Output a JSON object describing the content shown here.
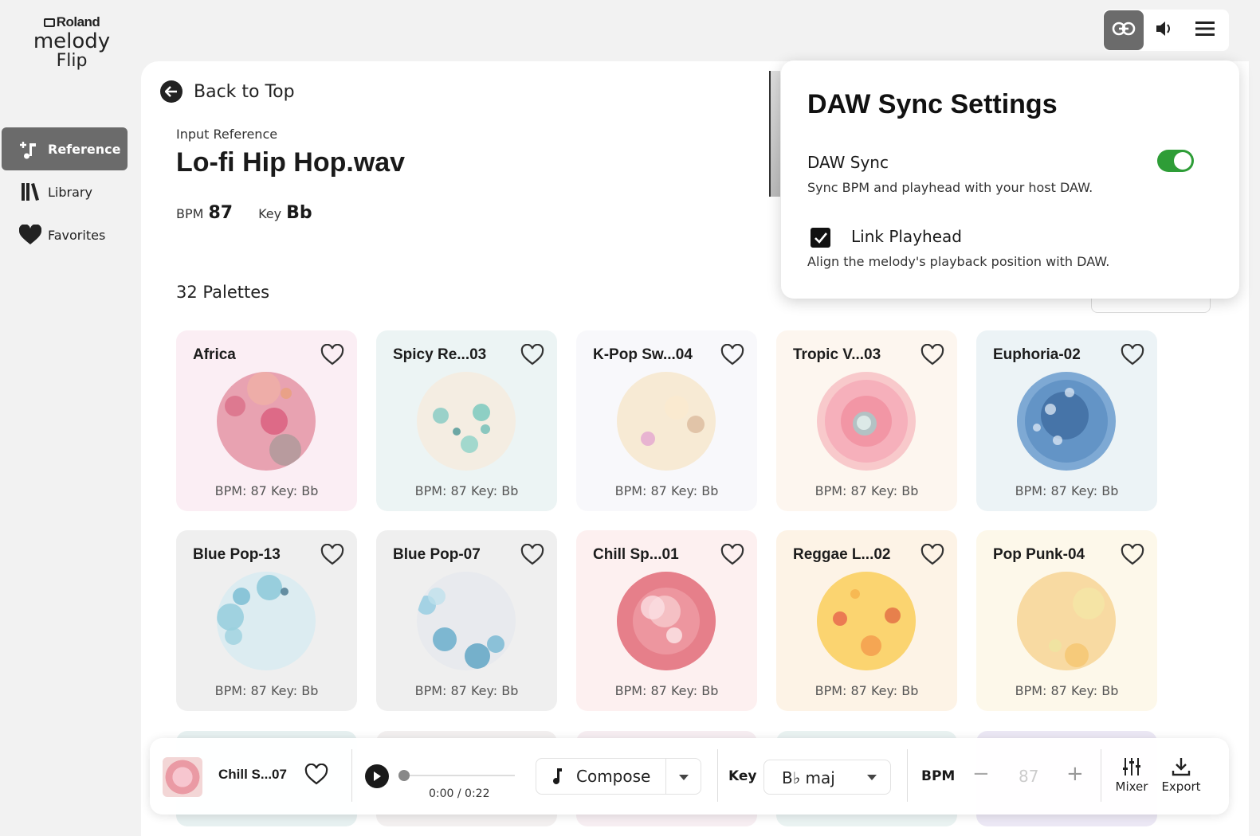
{
  "logo": {
    "brand": "Roland",
    "line1": "melody",
    "line2": "Flip"
  },
  "nav": [
    {
      "label": "Reference",
      "icon": "add-music-icon",
      "active": true
    },
    {
      "label": "Library",
      "icon": "library-icon",
      "active": false
    },
    {
      "label": "Favorites",
      "icon": "heart-filled-icon",
      "active": false
    }
  ],
  "toolbar": {
    "icons": [
      "link-icon",
      "speaker-icon",
      "menu-icon"
    ]
  },
  "main": {
    "back_label": "Back to Top",
    "input_ref_label": "Input Reference",
    "file_title": "Lo-fi Hip Hop.wav",
    "bpm_label": "BPM",
    "bpm_value": "87",
    "key_label": "Key",
    "key_value": "Bb",
    "palettes_count": "32 Palettes"
  },
  "cards": [
    {
      "title": "Africa",
      "info": "BPM: 87  Key: Bb",
      "bg": "#fbeef4",
      "orb": "#e8a2b1"
    },
    {
      "title": "Spicy Re...03",
      "info": "BPM: 87  Key: Bb",
      "bg": "#ecf4f4",
      "orb": "#f4ede2"
    },
    {
      "title": "K-Pop Sw...04",
      "info": "BPM: 87  Key: Bb",
      "bg": "#f8f8fb",
      "orb": "#f7ead4"
    },
    {
      "title": "Tropic V...03",
      "info": "BPM: 87  Key: Bb",
      "bg": "#fdf6ef",
      "orb": "#f8c9cb"
    },
    {
      "title": "Euphoria-02",
      "info": "BPM: 87  Key: Bb",
      "bg": "#ecf3f6",
      "orb": "#7ea9d4"
    },
    {
      "title": "Blue Pop-13",
      "info": "BPM: 87  Key: Bb",
      "bg": "#efefef",
      "orb": "#dcecf1"
    },
    {
      "title": "Blue Pop-07",
      "info": "BPM: 87  Key: Bb",
      "bg": "#efefef",
      "orb": "#e8eaee"
    },
    {
      "title": "Chill Sp...01",
      "info": "BPM: 87  Key: Bb",
      "bg": "#fdf0f0",
      "orb": "#e7878f"
    },
    {
      "title": "Reggae L...02",
      "info": "BPM: 87  Key: Bb",
      "bg": "#fdf3e6",
      "orb": "#fbd77a"
    },
    {
      "title": "Pop Punk-04",
      "info": "BPM: 87  Key: Bb",
      "bg": "#fdf8ea",
      "orb": "#f8dca8"
    }
  ],
  "popup": {
    "title": "DAW Sync Settings",
    "sync_label": "DAW Sync",
    "sync_desc": "Sync BPM and playhead with your host DAW.",
    "sync_on": true,
    "link_label": "Link Playhead",
    "link_desc": "Align the melody's playback position with DAW.",
    "link_checked": true
  },
  "player": {
    "track_name": "Chill S...07",
    "time": "0:00 / 0:22",
    "compose_label": "Compose",
    "key_label": "Key",
    "key_value": "B♭ maj",
    "bpm_label": "BPM",
    "bpm_value": "87",
    "minus": "−",
    "plus": "+",
    "mixer_label": "Mixer",
    "export_label": "Export"
  },
  "colors": {
    "accent_gray": "#6b6b6b",
    "toggle_green": "#2e9d37"
  }
}
